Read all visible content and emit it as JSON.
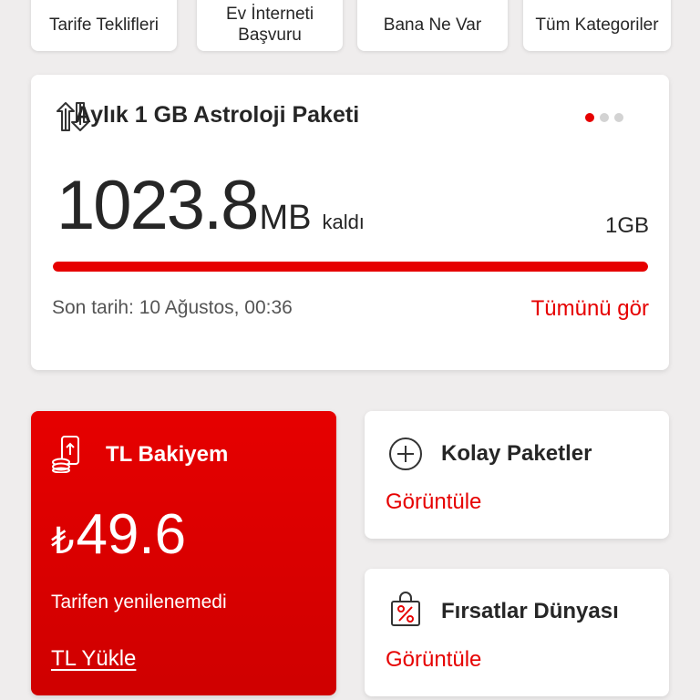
{
  "shortcuts": [
    {
      "label": "Tarife Teklifleri"
    },
    {
      "label": "Ev İnterneti\nBaşvuru"
    },
    {
      "label": "Bana Ne Var"
    },
    {
      "label": "Tüm Kategoriler"
    }
  ],
  "package": {
    "title": "Aylık 1 GB Astroloji Paketi",
    "remaining_value": "1023.8",
    "remaining_unit": "MB",
    "remaining_suffix": "kaldı",
    "total": "1GB",
    "used_fraction": 0.0002,
    "expiry": "Son tarih: 10 Ağustos, 00:36",
    "see_all": "Tümünü gör",
    "pager_count": 3,
    "pager_active": 0,
    "icon": "data-transfer-icon"
  },
  "balance": {
    "title": "TL Bakiyem",
    "currency": "₺",
    "amount": "49.6",
    "status": "Tarifen yenilenemedi",
    "action": "TL Yükle",
    "icon": "phone-coins-icon"
  },
  "easy_packages": {
    "title": "Kolay Paketler",
    "action": "Görüntüle",
    "icon": "plus-circle-icon"
  },
  "opportunities": {
    "title": "Fırsatlar Dünyası",
    "action": "Görüntüle",
    "icon": "discount-bag-icon"
  },
  "colors": {
    "accent": "#e60000",
    "background": "#efeded",
    "text": "#262626"
  }
}
